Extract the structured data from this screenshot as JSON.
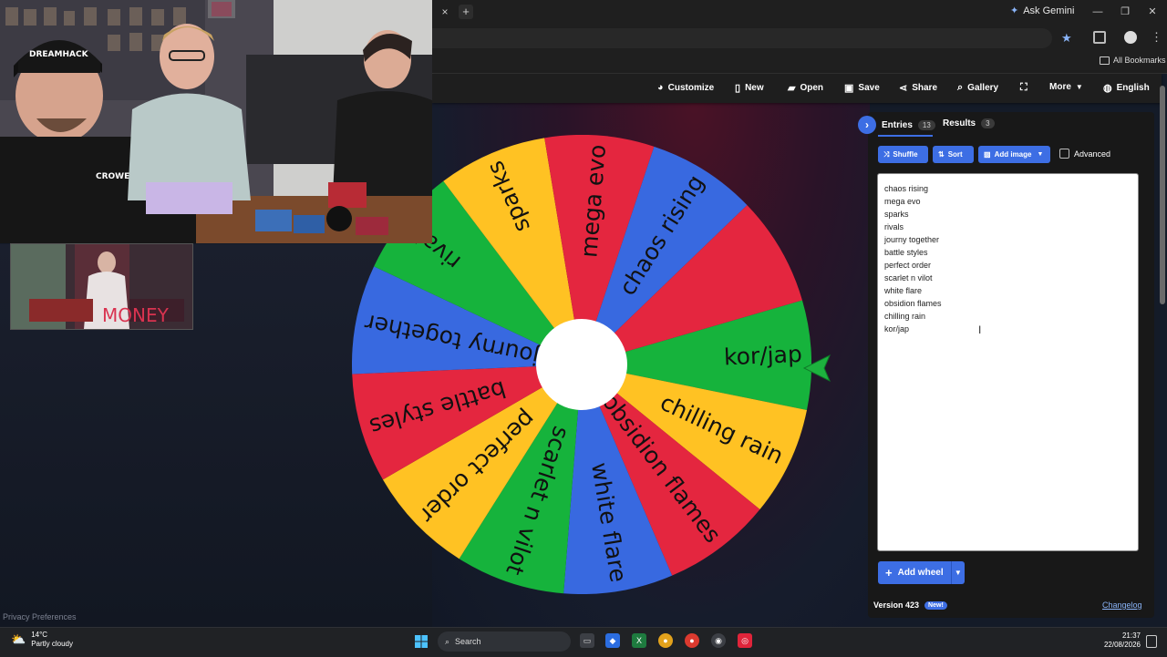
{
  "browser": {
    "tab_close": "×",
    "tab_new": "+",
    "ask_gemini": "Ask Gemini",
    "all_bookmarks": "All Bookmarks",
    "win_min": "—",
    "win_max": "❐",
    "win_close": "✕"
  },
  "nav": {
    "customize": "Customize",
    "new": "New",
    "open": "Open",
    "save": "Save",
    "share": "Share",
    "gallery": "Gallery",
    "more": "More",
    "language": "English"
  },
  "wheel": {
    "colors": [
      "#e4263f",
      "#3869e0",
      "#ffc223",
      "#16b33c"
    ],
    "pointer_color": "#1db23e",
    "slices": [
      {
        "label": "kor/jap",
        "color": "#16b33c"
      },
      {
        "label": "chilling rain",
        "color": "#ffc223"
      },
      {
        "label": "obsidion flames",
        "color": "#e4263f"
      },
      {
        "label": "white flare",
        "color": "#3869e0"
      },
      {
        "label": "scarlet n vilot",
        "color": "#16b33c"
      },
      {
        "label": "perfect order",
        "color": "#ffc223"
      },
      {
        "label": "battle styles",
        "color": "#e4263f"
      },
      {
        "label": "journy together",
        "color": "#3869e0"
      },
      {
        "label": "rivals",
        "color": "#16b33c"
      },
      {
        "label": "sparks",
        "color": "#ffc223"
      },
      {
        "label": "mega evo",
        "color": "#e4263f"
      },
      {
        "label": "chaos rising",
        "color": "#3869e0"
      },
      {
        "label": "",
        "color": "#e4263f"
      }
    ]
  },
  "panel": {
    "entries_tab": "Entries",
    "entries_count": "13",
    "results_tab": "Results",
    "results_count": "3",
    "shuffle": "Shuffle",
    "sort": "Sort",
    "add_image": "Add image",
    "advanced": "Advanced",
    "entries": [
      "chaos rising",
      "mega evo",
      "sparks",
      "rivals",
      "journy together",
      "battle styles",
      "perfect order",
      "scarlet n vilot",
      "white flare",
      "obsidion flames",
      "chilling rain",
      "kor/jap"
    ],
    "add_wheel": "Add wheel",
    "version": "Version 423",
    "new_badge": "New!",
    "changelog": "Changelog"
  },
  "overlay": {
    "privacy": "Privacy Preferences",
    "cap_text": "DREAMHACK",
    "shirt_text": "CROWE FEST",
    "clip_text": "MONEY"
  },
  "taskbar": {
    "temp": "14°C",
    "weather": "Partly cloudy",
    "search": "Search",
    "time": "21:37",
    "date": "22/08/2026"
  }
}
